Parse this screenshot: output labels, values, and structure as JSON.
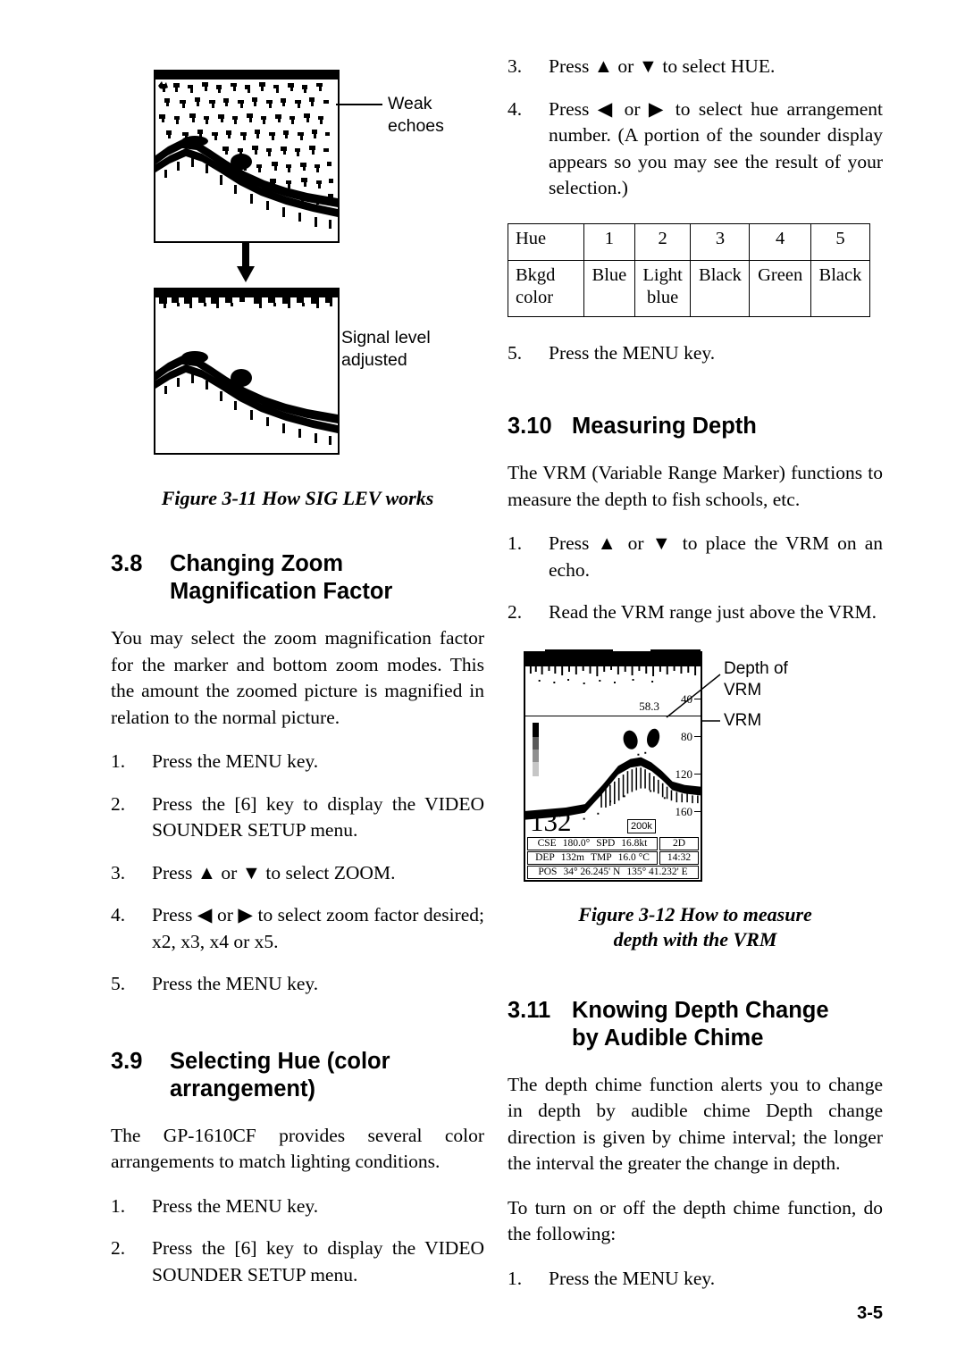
{
  "page": {
    "number": "3-5"
  },
  "figure_311": {
    "caption": "Figure 3-11 How SIG LEV works",
    "callouts": [
      {
        "label_line1": "Weak",
        "label_line2": "echoes"
      },
      {
        "label_line1": "Signal level",
        "label_line2": "adjusted"
      }
    ]
  },
  "section_38": {
    "number": "3.8",
    "title_line1": "Changing Zoom",
    "title_line2": "Magnification Factor",
    "intro": "You may select the zoom magnification factor for the marker and bottom zoom modes. This the amount the zoomed picture is magnified in relation to the normal picture.",
    "steps": [
      {
        "n": "1.",
        "text": "Press the MENU key."
      },
      {
        "n": "2.",
        "text": "Press the [6] key to display the VIDEO SOUNDER SETUP menu."
      },
      {
        "n": "3.",
        "text": "Press ▲ or ▼ to select ZOOM."
      },
      {
        "n": "4.",
        "text": "Press ◀ or ▶  to select zoom factor desired; x2, x3, x4 or x5."
      },
      {
        "n": "5.",
        "text": "Press the MENU key."
      }
    ]
  },
  "section_39": {
    "number": "3.9",
    "title_line1": "Selecting Hue (color",
    "title_line2": "arrangement)",
    "intro": "The GP-1610CF provides several color arrangements to match lighting conditions.",
    "steps_left": [
      {
        "n": "1.",
        "text": "Press the MENU key."
      },
      {
        "n": "2.",
        "text": "Press the [6] key to display the VIDEO SOUNDER SETUP menu."
      }
    ],
    "steps_right": [
      {
        "n": "3.",
        "text": "Press ▲ or ▼ to select HUE."
      },
      {
        "n": "4.",
        "text": "Press ◀ or ▶  to select hue arrangement number. (A portion of the sounder display appears so you may see the result of your selection.)"
      },
      {
        "n": "5.",
        "text": "Press the MENU key."
      }
    ],
    "hue_table": {
      "row1": [
        "Hue",
        "1",
        "2",
        "3",
        "4",
        "5"
      ],
      "row2_label": "Bkgd color",
      "row2": [
        "Blue",
        "Light blue",
        "Black",
        "Green",
        "Black"
      ]
    }
  },
  "section_310": {
    "number": "3.10",
    "title": "Measuring Depth",
    "intro": "The VRM (Variable Range Marker) functions to measure the depth to fish schools, etc.",
    "steps": [
      {
        "n": "1.",
        "text": "Press ▲ or ▼ to place the VRM on an echo."
      },
      {
        "n": "2.",
        "text": "Read the VRM range just above the VRM."
      }
    ]
  },
  "figure_312": {
    "caption_line1": "Figure 3-12 How to measure",
    "caption_line2": "depth with the VRM",
    "callout_depth_line1": "Depth of",
    "callout_depth_line2": "VRM",
    "callout_vrm": "VRM",
    "display": {
      "vrm_depth": "58.3",
      "scale_labels": [
        "40",
        "80",
        "120",
        "160"
      ],
      "depth_reading": "132",
      "frequency_badge": "200k",
      "status": {
        "cse_label": "CSE",
        "cse_value": "180.0°",
        "spd_label": "SPD",
        "spd_value": "16.8kt",
        "mode": "2D",
        "dep_label": "DEP",
        "dep_value": "132m",
        "tmp_label": "TMP",
        "tmp_value": "16.0 °C",
        "time": "14:32",
        "pos_label": "POS",
        "pos_lat": "34° 26.245' N",
        "pos_lon": "135° 41.232' E"
      }
    }
  },
  "section_311": {
    "number": "3.11",
    "title_line1": "Knowing Depth Change",
    "title_line2": "by Audible Chime",
    "para1": "The depth chime function alerts you to change in depth by audible chime Depth change direction is given by chime interval; the longer the interval the greater the change in depth.",
    "para2": "To turn on or off the depth chime function, do the following:",
    "steps": [
      {
        "n": "1.",
        "text": "Press the MENU key."
      }
    ]
  }
}
